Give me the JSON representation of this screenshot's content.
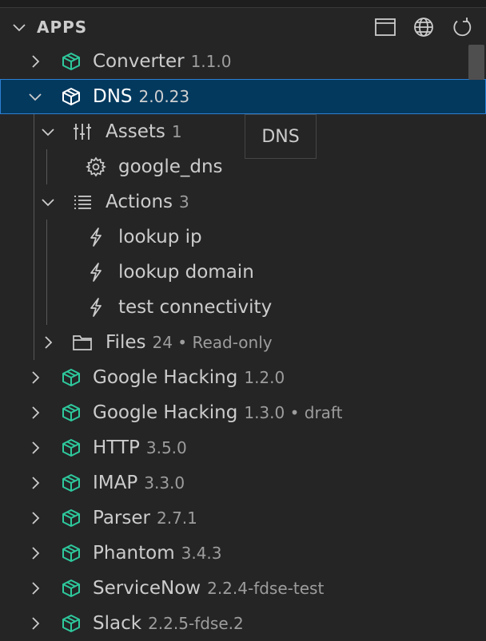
{
  "section": {
    "title": "APPS",
    "actions": [
      {
        "icon": "collapse-all-icon"
      },
      {
        "icon": "globe-icon"
      },
      {
        "icon": "refresh-icon"
      }
    ]
  },
  "tooltip": {
    "text": "DNS"
  },
  "tree": [
    {
      "label": "Converter",
      "desc": "1.1.0",
      "expanded": false,
      "selected": false
    },
    {
      "label": "DNS",
      "desc": "2.0.23",
      "expanded": true,
      "selected": true,
      "children": [
        {
          "label": "Assets",
          "desc": "1",
          "icon": "sliders-icon",
          "children": [
            {
              "label": "google_dns",
              "icon": "gear-icon"
            }
          ]
        },
        {
          "label": "Actions",
          "desc": "3",
          "icon": "list-icon",
          "children": [
            {
              "label": "lookup ip",
              "icon": "lightning-icon"
            },
            {
              "label": "lookup domain",
              "icon": "lightning-icon"
            },
            {
              "label": "test connectivity",
              "icon": "lightning-icon"
            }
          ]
        },
        {
          "label": "Files",
          "desc": "24 • Read-only",
          "icon": "folder-icon"
        }
      ]
    },
    {
      "label": "Google Hacking",
      "desc": "1.2.0",
      "expanded": false,
      "selected": false
    },
    {
      "label": "Google Hacking",
      "desc": "1.3.0 • draft",
      "expanded": false,
      "selected": false
    },
    {
      "label": "HTTP",
      "desc": "3.5.0",
      "expanded": false,
      "selected": false
    },
    {
      "label": "IMAP",
      "desc": "3.3.0",
      "expanded": false,
      "selected": false
    },
    {
      "label": "Parser",
      "desc": "2.7.1",
      "expanded": false,
      "selected": false
    },
    {
      "label": "Phantom",
      "desc": "3.4.3",
      "expanded": false,
      "selected": false
    },
    {
      "label": "ServiceNow",
      "desc": "2.2.4-fdse-test",
      "expanded": false,
      "selected": false
    },
    {
      "label": "Slack",
      "desc": "2.2.5-fdse.2",
      "expanded": false,
      "selected": false
    }
  ],
  "colors": {
    "background": "#252526",
    "selection": "#04395e",
    "selection_border": "#2b7fd4",
    "package_icon": "#2ec99c",
    "text": "#cccccc",
    "description": "#9d9d9d"
  }
}
